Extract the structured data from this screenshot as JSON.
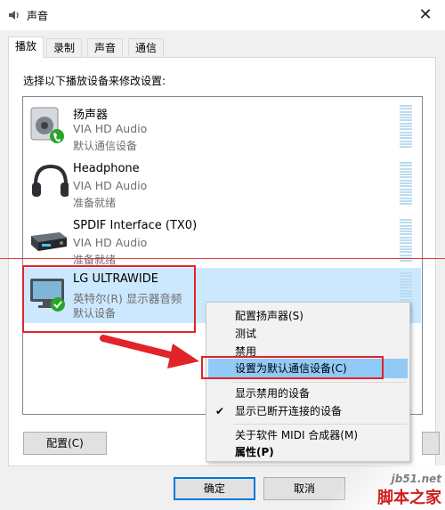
{
  "window": {
    "title": "声音",
    "close_glyph": "✕"
  },
  "tabs": [
    {
      "label": "播放",
      "active": true
    },
    {
      "label": "录制",
      "active": false
    },
    {
      "label": "声音",
      "active": false
    },
    {
      "label": "通信",
      "active": false
    }
  ],
  "instruction": "选择以下播放设备来修改设置:",
  "devices": [
    {
      "name": "扬声器",
      "driver": "VIA HD Audio",
      "status": "默认通信设备",
      "icon": "speaker-icon",
      "selected": false
    },
    {
      "name": "Headphone",
      "driver": "VIA HD Audio",
      "status": "准备就绪",
      "icon": "headphone-icon",
      "selected": false
    },
    {
      "name": "SPDIF Interface (TX0)",
      "driver": "VIA HD Audio",
      "status": "准备就绪",
      "icon": "spdif-device-icon",
      "selected": false
    },
    {
      "name": "LG ULTRAWIDE",
      "driver": "英特尔(R) 显示器音频",
      "status": "默认设备",
      "icon": "monitor-icon",
      "selected": true
    }
  ],
  "buttons": {
    "configure": "配置(C)",
    "ok": "确定",
    "cancel": "取消"
  },
  "context_menu": {
    "items": [
      {
        "label": "配置扬声器(S)"
      },
      {
        "label": "测试"
      },
      {
        "label": "禁用"
      },
      {
        "label": "设置为默认通信设备(C)",
        "highlighted": true
      },
      {
        "label": "显示禁用的设备"
      },
      {
        "label": "显示已断开连接的设备",
        "checked": true
      },
      {
        "label": "关于软件 MIDI 合成器(M)"
      },
      {
        "label": "属性(P)",
        "bold": true
      }
    ]
  },
  "watermark": {
    "url": "jb51.net",
    "name": "脚本之家"
  },
  "colors": {
    "selection": "#cce8ff",
    "menu_highlight": "#91c9f7",
    "annotation_red": "#e1242a",
    "status_green": "#2aa52a"
  }
}
